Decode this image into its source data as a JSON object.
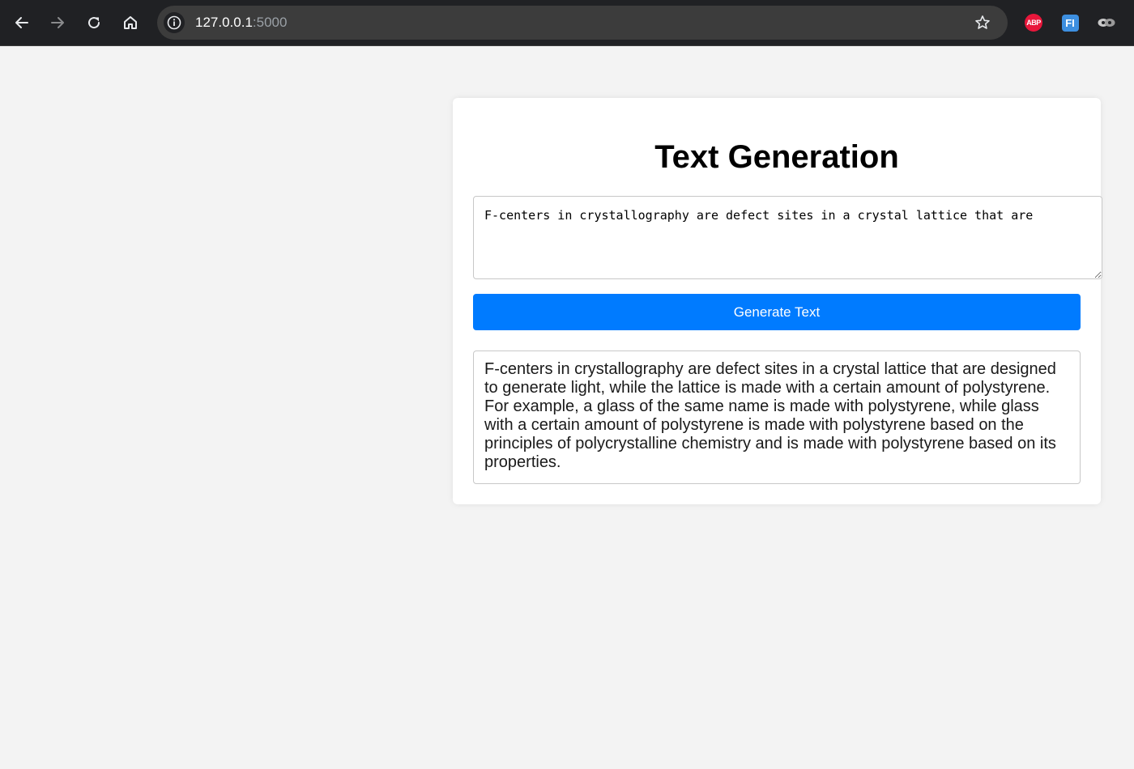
{
  "browser": {
    "url_host": "127.0.0.1",
    "url_port": ":5000",
    "icons": [
      "back-arrow-icon",
      "forward-arrow-icon",
      "reload-icon",
      "home-icon",
      "site-info-icon",
      "bookmark-star-icon",
      "adblock-plus-extension-icon",
      "fi-extension-icon",
      "extensions-puzzle-icon"
    ],
    "extensions": {
      "abp_label": "ABP",
      "fi_label": "FI"
    }
  },
  "page": {
    "title": "Text Generation",
    "prompt_value": "F-centers in crystallography are defect sites in a crystal lattice that are",
    "generate_button_label": "Generate Text",
    "output_text": "F-centers in crystallography are defect sites in a crystal lattice that are designed to generate light, while the lattice is made with a certain amount of polystyrene. For example, a glass of the same name is made with polystyrene, while glass with a certain amount of polystyrene is made with polystyrene based on the principles of polycrystalline chemistry and is made with polystyrene based on its properties."
  },
  "colors": {
    "browser_bar": "#202124",
    "omnibox": "#3c3c3c",
    "page_background": "#f3f3f3",
    "primary_button": "#007bff",
    "abp_red": "#e8173b"
  }
}
